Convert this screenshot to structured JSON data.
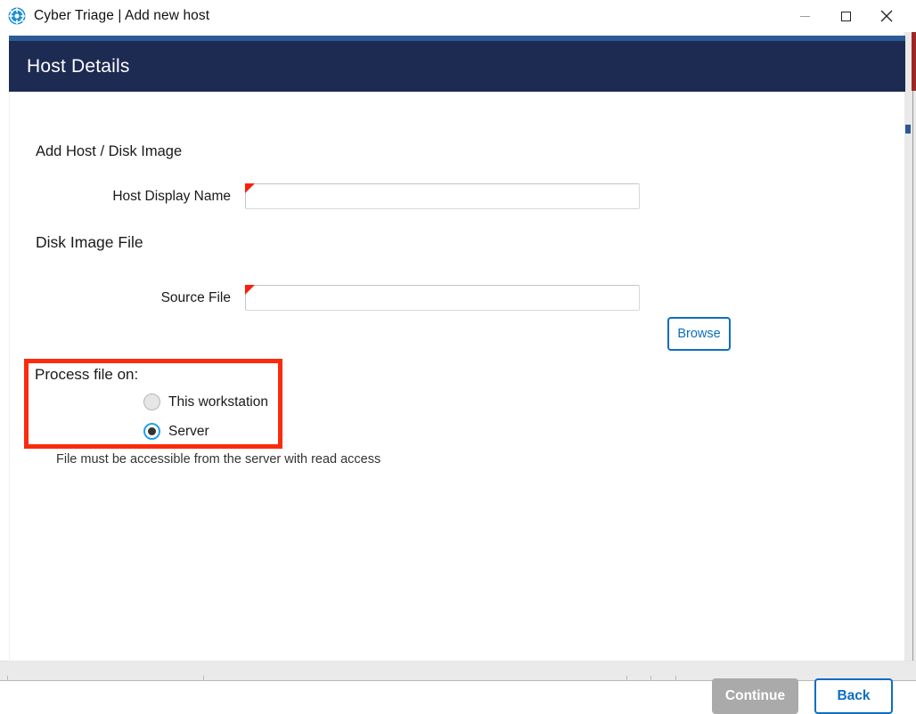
{
  "window": {
    "title": "Cyber Triage | Add new host",
    "logo_icon": "cyber-triage-logo-icon",
    "controls": {
      "minimize": "minimize-icon",
      "maximize": "maximize-icon",
      "close": "close-icon"
    }
  },
  "dialog": {
    "header_title": "Host Details",
    "header_bg": "#1d2a52",
    "accent_bar": "#2c5a96",
    "breadcrumb": "Add Host / Disk Image",
    "fields": {
      "host_display_name": {
        "label": "Host Display Name",
        "value": "",
        "placeholder": "",
        "required": true
      },
      "source_file": {
        "label": "Source File",
        "value": "",
        "placeholder": "",
        "required": true
      }
    },
    "section_heading": "Disk Image File",
    "browse_label": "Browse",
    "process_on": {
      "title": "Process file on:",
      "options": [
        {
          "label": "This workstation",
          "selected": false
        },
        {
          "label": "Server",
          "selected": true
        }
      ],
      "helper_note": "File must be accessible from the server with read access",
      "highlight_color": "#fb2b0d"
    },
    "footer": {
      "continue_label": "Continue",
      "continue_enabled": false,
      "back_label": "Back"
    },
    "colors": {
      "primary_blue": "#0d6ebf",
      "required_marker": "#fa1e0e",
      "disabled_gray": "#aaaaaa",
      "radio_selected_ring": "#23a0e8"
    }
  }
}
